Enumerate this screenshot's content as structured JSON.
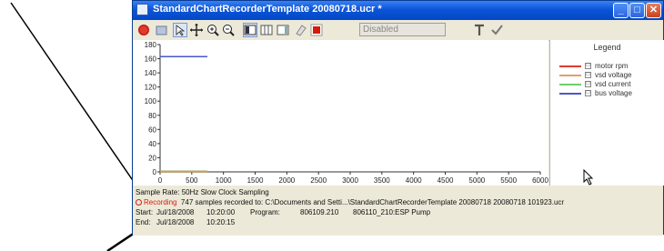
{
  "window": {
    "title": "StandardChartRecorderTemplate 20080718.ucr *",
    "controls": {
      "minimize": "_",
      "maximize": "□",
      "close": "✕"
    }
  },
  "toolbar": {
    "status_field": "Disabled",
    "icons": [
      "record-icon",
      "properties-icon",
      "select-icon",
      "pan-icon",
      "zoom-in-icon",
      "zoom-out-icon",
      "layout1-icon",
      "layout2-icon",
      "layout3-icon",
      "eraser-icon",
      "stop-icon",
      "text-icon",
      "check-icon"
    ]
  },
  "legend": {
    "title": "Legend",
    "items": [
      {
        "label": "motor rpm",
        "color": "#e03c2f"
      },
      {
        "label": "vsd voltage",
        "color": "#e0a070"
      },
      {
        "label": "vsd current",
        "color": "#6ccf6c"
      },
      {
        "label": "bus voltage",
        "color": "#4a57c8"
      }
    ]
  },
  "chart_data": {
    "type": "line",
    "x_ticks": [
      "0",
      "500",
      "1000",
      "1500",
      "2000",
      "2500",
      "3000",
      "3500",
      "4000",
      "4500",
      "5000",
      "5500",
      "6000"
    ],
    "y_ticks": [
      "0",
      "20",
      "40",
      "60",
      "80",
      "100",
      "120",
      "140",
      "160",
      "180"
    ],
    "xlim": [
      0,
      6000
    ],
    "ylim": [
      0,
      180
    ],
    "grid": false,
    "legend_position": "right",
    "series": [
      {
        "name": "motor rpm",
        "color": "#e03c2f",
        "x": [
          0,
          747
        ],
        "y": [
          0,
          0
        ]
      },
      {
        "name": "vsd voltage",
        "color": "#c48e5c",
        "x": [
          0,
          747
        ],
        "y": [
          1,
          1
        ]
      },
      {
        "name": "vsd current",
        "color": "#6ccf6c",
        "x": [
          0,
          747
        ],
        "y": [
          0.5,
          0.5
        ]
      },
      {
        "name": "bus voltage",
        "color": "#4a57c8",
        "x": [
          0,
          747
        ],
        "y": [
          163,
          163
        ]
      }
    ]
  },
  "info": {
    "sample_rate": "Sample Rate: 50Hz Slow Clock Sampling",
    "recording_label": "Recording",
    "recording_text": "747 samples recorded to: C:\\Documents and Setti...\\StandardChartRecorderTemplate 20080718 20080718 101923.ucr",
    "start_label": "Start:",
    "start_date": "Jul/18/2008",
    "start_time": "10:20:00",
    "program_label": "Program:",
    "program_id": "806109.210",
    "program_name": "806110_210:ESP Pump",
    "end_label": "End:",
    "end_date": "Jul/18/2008",
    "end_time": "10:20:15"
  }
}
